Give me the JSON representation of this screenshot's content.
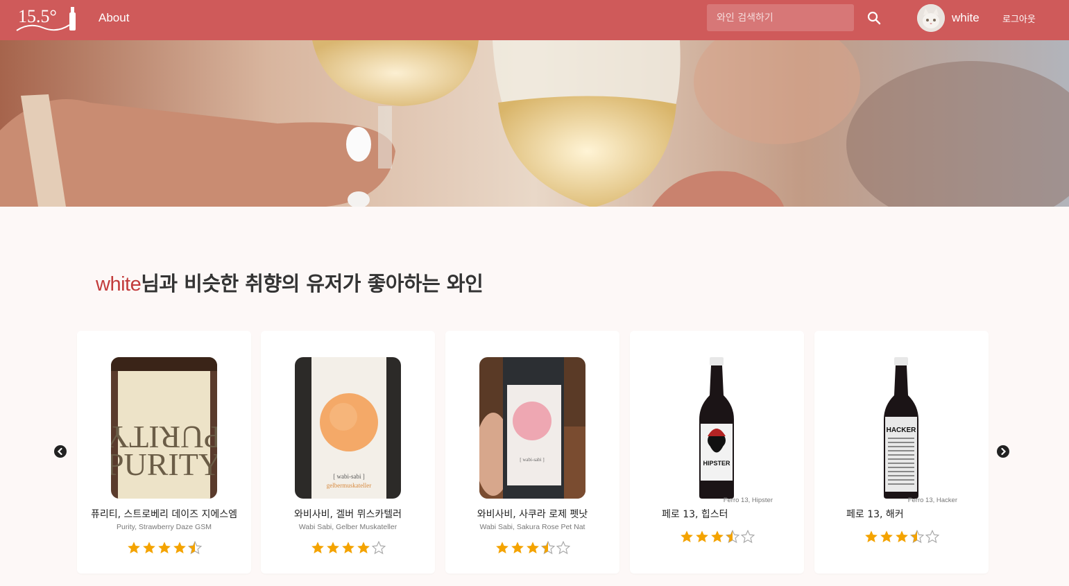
{
  "nav": {
    "logo_text": "15.5°",
    "about_label": "About",
    "search_placeholder": "와인 검색하기",
    "username": "white",
    "logout_label": "로그아웃"
  },
  "section": {
    "title_user": "white",
    "title_rest": "님과 비슷한 취향의 유저가 좋아하는 와인"
  },
  "wines": [
    {
      "name": "퓨리티, 스트로베리 데이즈 지에스엠",
      "eng": "Purity, Strawberry Daze GSM",
      "rating": 4.5
    },
    {
      "name": "와비사비, 겔버 뮈스카텔러",
      "eng": "Wabi Sabi, Gelber Muskateller",
      "rating": 4
    },
    {
      "name": "와비사비, 사쿠라 로제 펫낫",
      "eng": "Wabi Sabi, Sakura Rose Pet Nat",
      "rating": 3.5
    },
    {
      "name": "페로 13, 힙스터",
      "eng": "Ferro 13, Hipster",
      "rating": 3.5
    },
    {
      "name": "페로 13, 해커",
      "eng": "Ferro 13, Hacker",
      "rating": 3.5
    }
  ],
  "colors": {
    "nav": "#cf5a5a",
    "accent": "#c23b3b",
    "star": "#f4a300"
  }
}
